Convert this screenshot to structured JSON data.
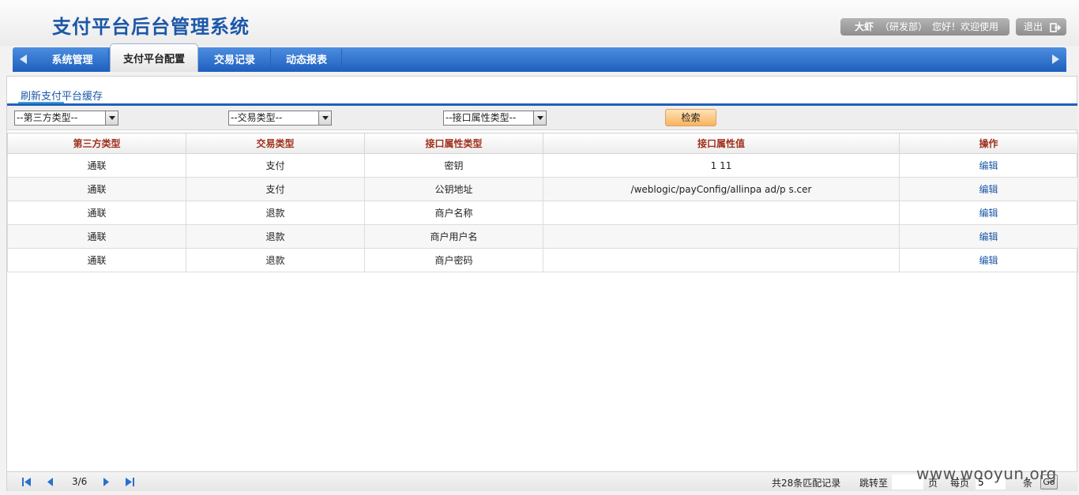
{
  "header": {
    "title": "支付平台后台管理系统",
    "user_name": "大虾",
    "user_dept": "（研发部）",
    "greeting": "您好！欢迎使用",
    "logout_label": "退出"
  },
  "nav": {
    "tabs": [
      {
        "label": "系统管理"
      },
      {
        "label": "支付平台配置"
      },
      {
        "label": "交易记录"
      },
      {
        "label": "动态报表"
      }
    ],
    "active_tab": "支付平台配置"
  },
  "panel": {
    "refresh_link": "刷新支付平台缓存"
  },
  "filters": {
    "third_party_type": "--第三方类型--",
    "trade_type": "--交易类型--",
    "attr_type": "--接口属性类型--",
    "search_label": "检索"
  },
  "table": {
    "columns": [
      "第三方类型",
      "交易类型",
      "接口属性类型",
      "接口属性值",
      "操作"
    ],
    "rows": [
      {
        "third_party": "通联",
        "trade": "支付",
        "attr_type": "密钥",
        "attr_value": "1      11",
        "action": "编辑"
      },
      {
        "third_party": "通联",
        "trade": "支付",
        "attr_type": "公钥地址",
        "attr_value": "/weblogic/payConfig/allinpa    ad/p          s.cer",
        "action": "编辑"
      },
      {
        "third_party": "通联",
        "trade": "退款",
        "attr_type": "商户名称",
        "attr_value": "",
        "action": "编辑"
      },
      {
        "third_party": "通联",
        "trade": "退款",
        "attr_type": "商户用户名",
        "attr_value": "",
        "action": "编辑"
      },
      {
        "third_party": "通联",
        "trade": "退款",
        "attr_type": "商户密码",
        "attr_value": "",
        "action": "编辑"
      }
    ]
  },
  "pager": {
    "page_info": "3/6",
    "total": "共28条匹配记录",
    "jump_label": "跳转至",
    "page_unit": "页",
    "per_page_label": "每页",
    "per_page_value": "5",
    "per_page_unit": "条",
    "go_label": "Go"
  },
  "watermark": "www.wooyun.org",
  "colors": {
    "title_blue": "#1c57a8",
    "nav_blue": "#1e5fbe",
    "header_text_red": "#a0301c",
    "search_orange": "#f7b45e"
  }
}
